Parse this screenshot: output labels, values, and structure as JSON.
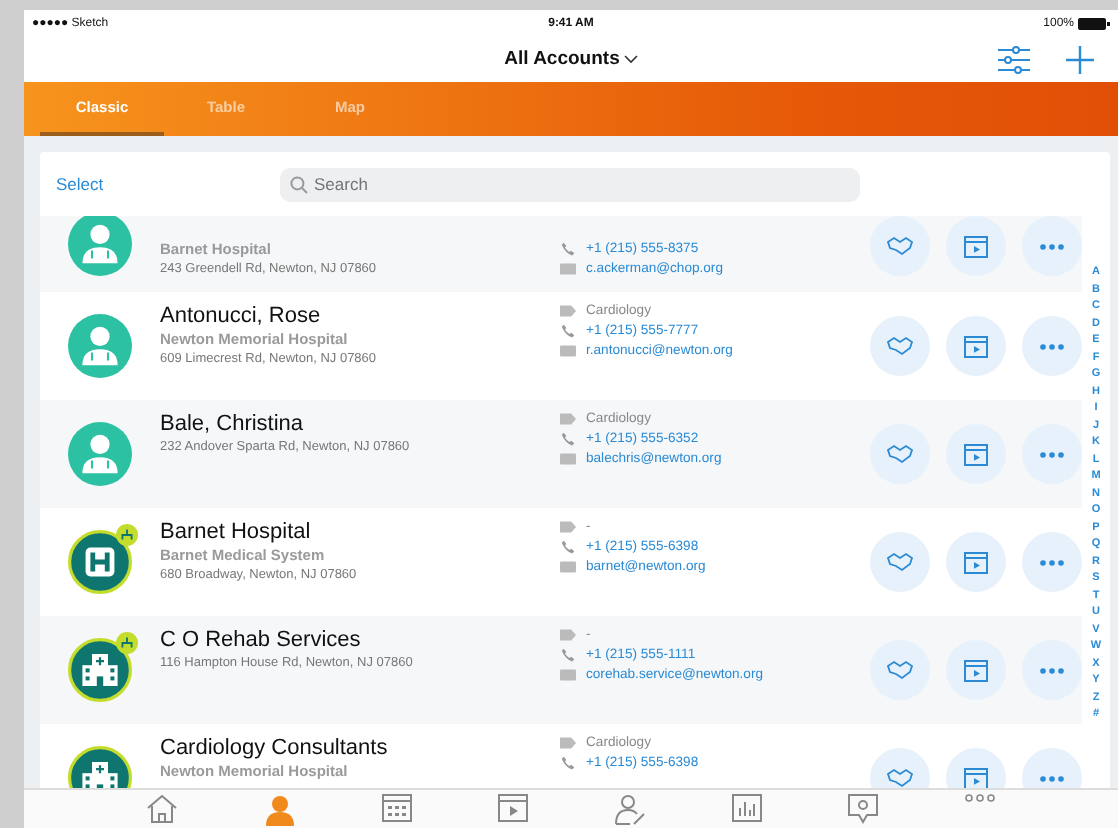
{
  "status_bar": {
    "carrier": "●●●●● Sketch",
    "time": "9:41 AM",
    "battery": "100%"
  },
  "nav": {
    "title": "All Accounts"
  },
  "view_tabs": [
    {
      "label": "Classic",
      "selected": true
    },
    {
      "label": "Table",
      "selected": false
    },
    {
      "label": "Map",
      "selected": false
    }
  ],
  "toolbar": {
    "select": "Select",
    "search": {
      "placeholder": "Search"
    }
  },
  "accounts": [
    {
      "kind": "doctor",
      "network": false,
      "organization": "Barnet Hospital",
      "address": "243 Greendell Rd, Newton, NJ 07860",
      "phone": "+1 (215) 555-8375",
      "email": "c.ackerman@chop.org"
    },
    {
      "kind": "doctor",
      "network": false,
      "name": "Antonucci, Rose",
      "organization": "Newton Memorial Hospital",
      "address": "609 Limecrest Rd, Newton, NJ 07860",
      "specialty": "Cardiology",
      "phone": "+1 (215) 555-7777",
      "email": "r.antonucci@newton.org"
    },
    {
      "kind": "doctor",
      "network": false,
      "name": "Bale, Christina",
      "address": "232 Andover Sparta Rd, Newton, NJ 07860",
      "specialty": "Cardiology",
      "phone": "+1 (215) 555-6352",
      "email": "balechris@newton.org"
    },
    {
      "kind": "hospital",
      "network": true,
      "name": "Barnet Hospital",
      "organization": "Barnet Medical System",
      "address": "680 Broadway, Newton, NJ 07860",
      "specialty": "-",
      "phone": "+1 (215) 555-6398",
      "email": "barnet@newton.org"
    },
    {
      "kind": "building",
      "network": true,
      "name": "C O Rehab Services",
      "address": "116 Hampton House Rd, Newton, NJ 07860",
      "specialty": "-",
      "phone": "+1 (215) 555-1111",
      "email": "corehab.service@newton.org"
    },
    {
      "kind": "building",
      "network": false,
      "name": "Cardiology Consultants",
      "organization": "Newton Memorial Hospital",
      "specialty": "Cardiology",
      "phone": "+1 (215) 555-6398"
    }
  ],
  "index": [
    "A",
    "B",
    "C",
    "D",
    "E",
    "F",
    "G",
    "H",
    "I",
    "J",
    "K",
    "L",
    "M",
    "N",
    "O",
    "P",
    "Q",
    "R",
    "S",
    "T",
    "U",
    "V",
    "W",
    "X",
    "Y",
    "Z",
    "#"
  ],
  "tab_bar": [
    {
      "kind": "home",
      "selected": false
    },
    {
      "kind": "accounts",
      "selected": true
    },
    {
      "kind": "calendar",
      "selected": false
    },
    {
      "kind": "media",
      "selected": false
    },
    {
      "kind": "contact",
      "selected": false
    },
    {
      "kind": "chart",
      "selected": false
    },
    {
      "kind": "feedback",
      "selected": false
    },
    {
      "kind": "more",
      "selected": false
    }
  ]
}
